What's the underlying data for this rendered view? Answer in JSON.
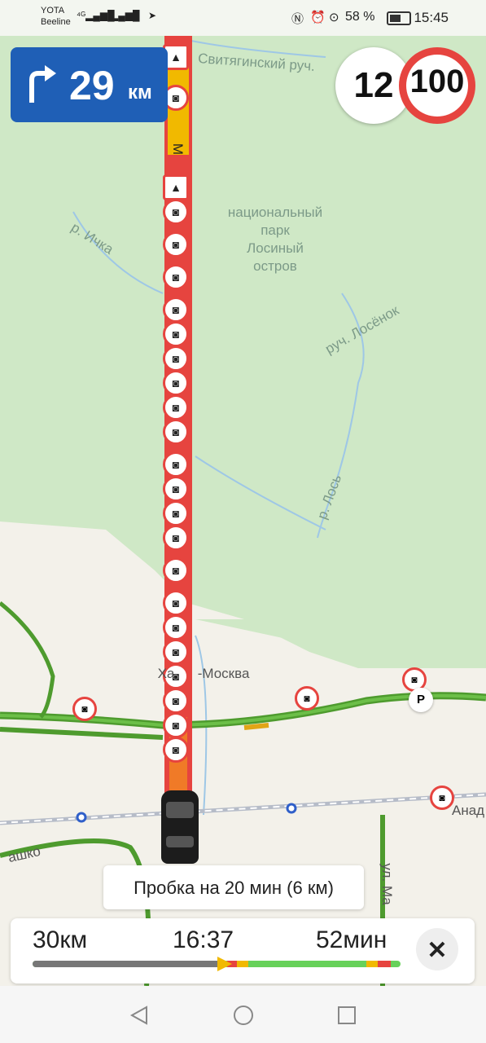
{
  "status_bar": {
    "carrier1": "YOTA",
    "carrier2": "Beeline",
    "battery": "58 %",
    "time": "15:45"
  },
  "map": {
    "labels": {
      "stream1": "Свитягинский руч.",
      "park": "национальный\nпарк\nЛосиный\nостров",
      "river1": "р. Ичка",
      "stream2": "руч. Лосёнок",
      "river2": "р. Лось",
      "town": "Ха      -Москва",
      "street1": "ул. Ма",
      "street2": "Анад",
      "street3": "ашко",
      "road_ref": "М"
    }
  },
  "maneuver": {
    "distance": "29",
    "unit": "км",
    "icon": "turn-right-icon"
  },
  "speed": {
    "current": "12",
    "limit": "100"
  },
  "traffic_toast": {
    "text": "Пробка на 20 мин (6 км)"
  },
  "route_panel": {
    "remaining_distance": "30км",
    "arrival_time": "16:37",
    "remaining_time": "52мин",
    "progress": 0.52,
    "colors": {
      "done": "#777777",
      "free": "#67d15a",
      "slow": "#f1b900",
      "jam": "#e6443f"
    }
  },
  "nav_bar": {
    "back": "back-icon",
    "home": "home-icon",
    "recent": "recent-apps-icon"
  }
}
